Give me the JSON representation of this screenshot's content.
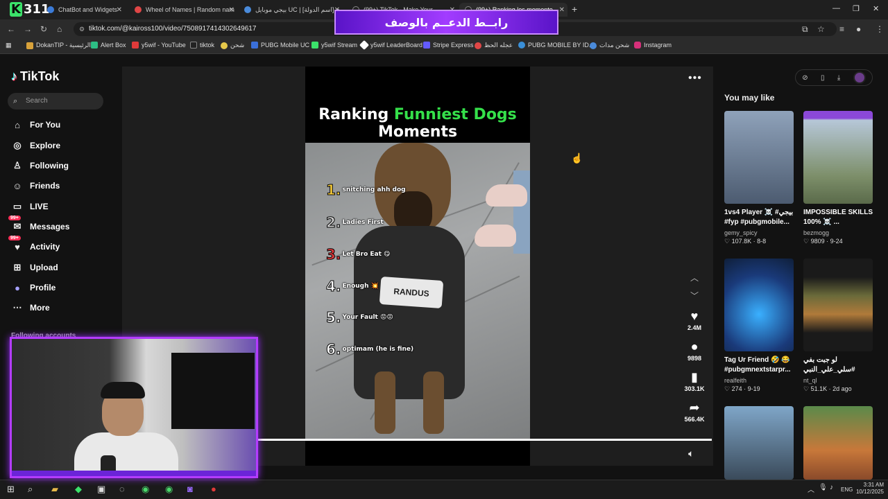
{
  "browser": {
    "stream_label": "311",
    "tabs": [
      {
        "label": "ChatBot and Widgets",
        "color": "#3b7bd8"
      },
      {
        "label": "Wheel of Names | Random nam",
        "color": "#e04646"
      },
      {
        "label": "بيجي موبايل UC | [اسم الدولة] خ",
        "color": "#4a8bdb"
      },
      {
        "label": "(99+) TikTok - Make Your",
        "color": "#222222"
      },
      {
        "label": "(99+) Ranking los momento",
        "color": "#222222"
      }
    ],
    "banner_text": "رابــط الدعــم بالوصف",
    "url": "tiktok.com/@kaiross100/video/7508917414302649617",
    "bookmarks": [
      {
        "label": "DokanTIP - الرئيسية",
        "color": "#d8a23a"
      },
      {
        "label": "Alert Box",
        "color": "#2dbd84"
      },
      {
        "label": "y5wif - YouTube",
        "color": "#e03a3a"
      },
      {
        "label": "tiktok",
        "color": "#222222"
      },
      {
        "label": "شحن",
        "color": "#e6c84a"
      },
      {
        "label": "PUBG Mobile UC",
        "color": "#3a6fd8"
      },
      {
        "label": "y5wif Stream",
        "color": "#3be26a"
      },
      {
        "label": "y5wif LeaderBoard",
        "color": "#ffffff"
      },
      {
        "label": "Stripe Express",
        "color": "#635bff"
      },
      {
        "label": "عجله الحظ",
        "color": "#e04646"
      },
      {
        "label": "PUBG MOBILE BY ID...",
        "color": "#3a8fd8"
      },
      {
        "label": "شحن مدات",
        "color": "#4a8bdb"
      },
      {
        "label": "Instagram",
        "color": "#d6307a"
      }
    ]
  },
  "tiktok": {
    "logo": "TikTok",
    "search_placeholder": "Search",
    "nav": [
      {
        "label": "For You",
        "icon": "home-icon"
      },
      {
        "label": "Explore",
        "icon": "compass-icon"
      },
      {
        "label": "Following",
        "icon": "following-icon"
      },
      {
        "label": "Friends",
        "icon": "friends-icon"
      },
      {
        "label": "LIVE",
        "icon": "live-icon"
      },
      {
        "label": "Messages",
        "icon": "messages-icon",
        "badge": "99+"
      },
      {
        "label": "Activity",
        "icon": "activity-icon",
        "badge": "99+"
      },
      {
        "label": "Upload",
        "icon": "upload-icon"
      },
      {
        "label": "Profile",
        "icon": "profile-icon"
      },
      {
        "label": "More",
        "icon": "more-icon"
      }
    ],
    "following_accounts_label": "Following accounts"
  },
  "video": {
    "title_prefix": "Ranking ",
    "title_highlight": "Funniest Dogs",
    "title_suffix": "Moments",
    "patch_text": "RANDUS",
    "rankings": [
      {
        "num": "1.",
        "label": "snitching ahh dog",
        "color": "#ffd23a"
      },
      {
        "num": "2.",
        "label": "Ladies First",
        "color": "#cfcfcf"
      },
      {
        "num": "3.",
        "label": "Let Bro Eat 😋",
        "color": "#e23a3a"
      },
      {
        "num": "4.",
        "label": "Enough 💥",
        "color": "#ffffff"
      },
      {
        "num": "5.",
        "label": "Your Fault 😡😡",
        "color": "#ffffff"
      },
      {
        "num": "6.",
        "label": "optimam (he is fine)",
        "color": "#ffffff"
      }
    ],
    "progress": 1.0,
    "actions": {
      "likes": "2.4M",
      "comments": "9898",
      "saves": "303.1K",
      "shares": "566.4K"
    }
  },
  "recommendations": {
    "heading": "You may like",
    "items": [
      {
        "title": "1vs4 Player ☠️ #بيجي #fyp #pubgmobile...",
        "user": "gemy_spicy",
        "likes": "107.8K",
        "date": "8-8",
        "thumb_bg": "#5c6f86"
      },
      {
        "title": "IMPOSSIBLE SKILLS 100% ☠️ ...",
        "user": "bezmogg",
        "likes": "9809",
        "date": "9-24",
        "thumb_bg": "#7a8ea8"
      },
      {
        "title": "Tag Ur Friend 🤣 😂 #pubgmnextstarpr...",
        "user": "realfeith",
        "likes": "274",
        "date": "9-19",
        "thumb_bg": "#2a4a8a"
      },
      {
        "title": "لو جبت بفي #سلي_علي_النبي #اذكروا_الله #بيبز #محمد",
        "user": "nt_ql",
        "likes": "51.1K",
        "date": "2d ago",
        "thumb_bg": "#3a3a3a"
      },
      {
        "title": "",
        "user": "",
        "likes": "",
        "date": "",
        "thumb_bg": "#6a8fb0"
      },
      {
        "title": "",
        "user": "",
        "likes": "",
        "date": "",
        "thumb_bg": "#9b6a4a"
      }
    ]
  },
  "taskbar": {
    "lang": "ENG",
    "time": "3:31 AM",
    "date": "10/12/2025"
  }
}
